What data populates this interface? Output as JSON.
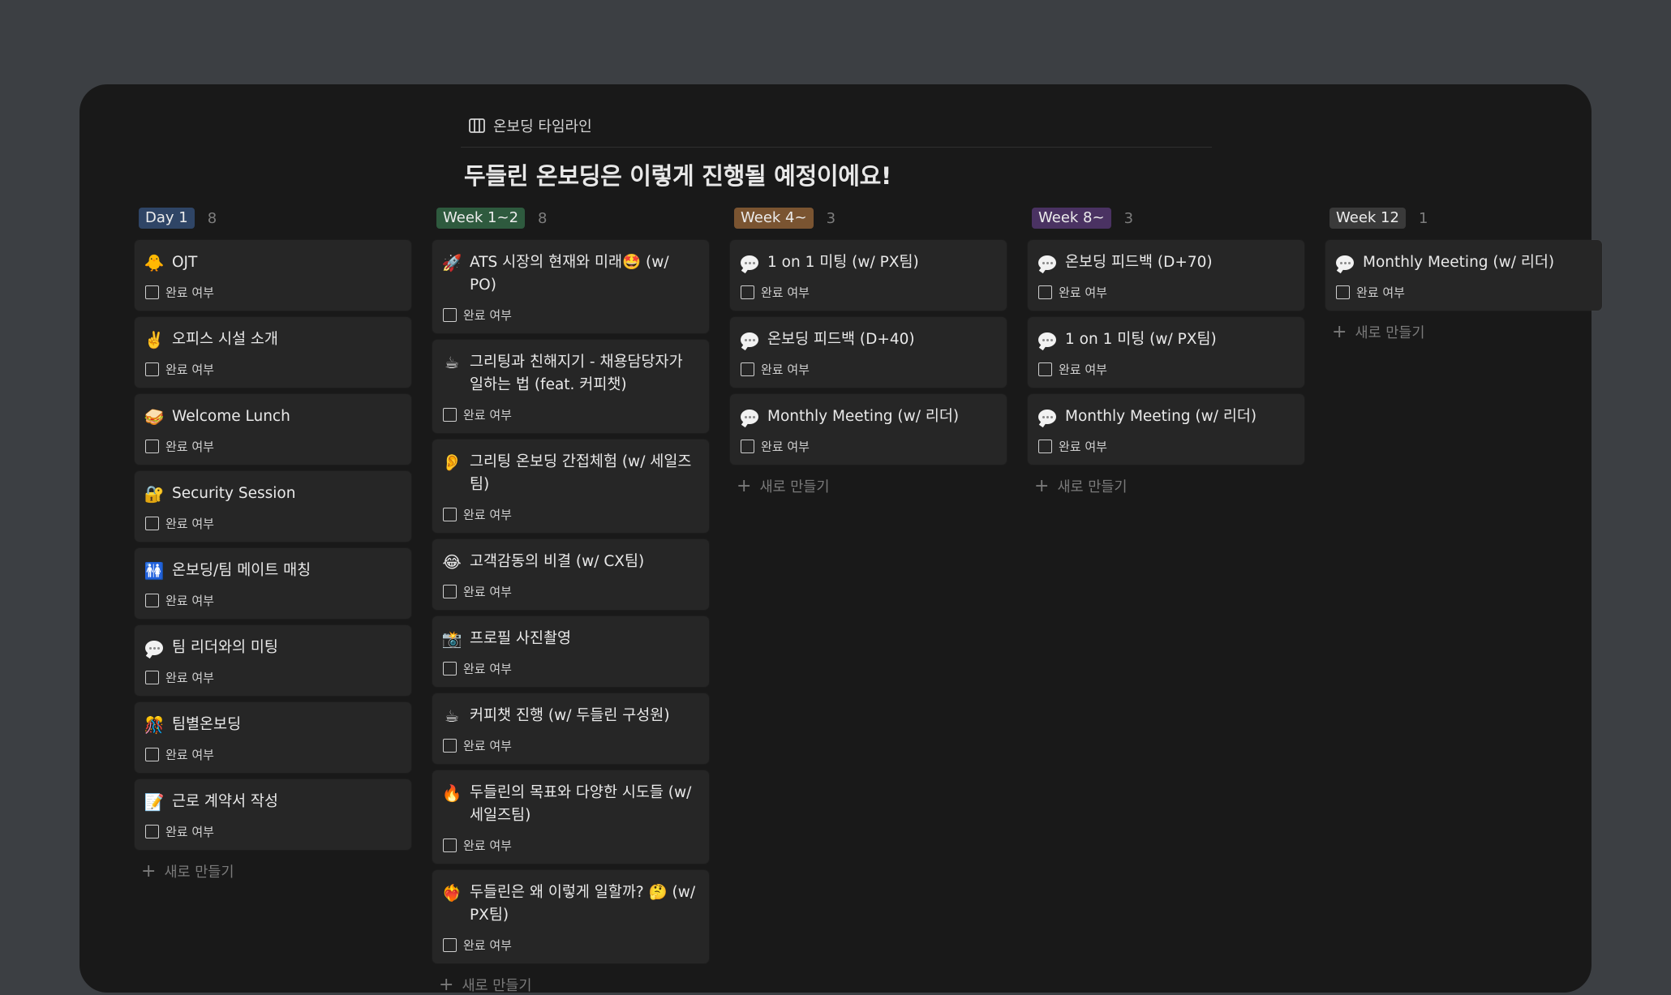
{
  "view": {
    "label": "온보딩 타임라인",
    "icon": "board-view-icon"
  },
  "page_title": "두들린 온보딩은 이렇게 진행될 예정이에요!",
  "checkbox_label": "완료 여부",
  "new_label": "새로 만들기",
  "columns": [
    {
      "name": "Day 1",
      "count": "8",
      "color": "#2f4566",
      "cards": [
        {
          "title": "OJT",
          "emoji": "🐥",
          "icon": "chick-icon"
        },
        {
          "title": "오피스 시설 소개",
          "emoji": "✌️",
          "icon": "victory-hand-icon"
        },
        {
          "title": "Welcome Lunch",
          "emoji": "🥪",
          "icon": "sandwich-icon"
        },
        {
          "title": "Security Session",
          "emoji": "🔐",
          "icon": "lock-key-icon"
        },
        {
          "title": "온보딩/팀 메이트 매칭",
          "emoji": "🚻",
          "icon": "people-icon"
        },
        {
          "title": "팀 리더와의 미팅",
          "emoji": "💬",
          "icon": "speech-bubble-icon"
        },
        {
          "title": "팀별온보딩",
          "emoji": "🎊",
          "icon": "celebration-icon"
        },
        {
          "title": "근로 계약서 작성",
          "emoji": "📝",
          "icon": "memo-icon"
        }
      ]
    },
    {
      "name": "Week 1~2",
      "count": "8",
      "color": "#2e5a3e",
      "cards": [
        {
          "title": "ATS 시장의 현재와 미래🤩 (w/ PO)",
          "emoji": "🚀",
          "icon": "rocket-icon"
        },
        {
          "title": "그리팅과 친해지기 - 채용담당자가 일하는 법 (feat. 커피챗)",
          "emoji": "☕",
          "icon": "coffee-icon"
        },
        {
          "title": "그리팅 온보딩 간접체험 (w/ 세일즈팀)",
          "emoji": "👂",
          "icon": "ear-icon"
        },
        {
          "title": "고객감동의 비결 (w/ CX팀)",
          "emoji": "😂",
          "icon": "tears-of-joy-icon"
        },
        {
          "title": "프로필 사진촬영",
          "emoji": "📸",
          "icon": "camera-icon"
        },
        {
          "title": "커피챗 진행 (w/ 두들린 구성원)",
          "emoji": "☕",
          "icon": "coffee-icon"
        },
        {
          "title": "두들린의 목표와 다양한 시도들 (w/ 세일즈팀)",
          "emoji": "🔥",
          "icon": "fire-icon"
        },
        {
          "title": "두들린은 왜 이렇게 일할까? 🤔 (w/ PX팀)",
          "emoji": "❤️‍🔥",
          "icon": "heart-on-fire-icon"
        }
      ]
    },
    {
      "name": "Week 4~",
      "count": "3",
      "color": "#7a5431",
      "cards": [
        {
          "title": "1 on 1 미팅 (w/ PX팀)",
          "emoji": "💬",
          "icon": "speech-bubble-icon"
        },
        {
          "title": "온보딩 피드백 (D+40)",
          "emoji": "💬",
          "icon": "speech-bubble-icon"
        },
        {
          "title": "Monthly Meeting (w/ 리더)",
          "emoji": "💬",
          "icon": "speech-bubble-icon"
        }
      ]
    },
    {
      "name": "Week 8~",
      "count": "3",
      "color": "#4a3262",
      "cards": [
        {
          "title": "온보딩 피드백 (D+70)",
          "emoji": "💬",
          "icon": "speech-bubble-icon"
        },
        {
          "title": "1 on 1 미팅 (w/ PX팀)",
          "emoji": "💬",
          "icon": "speech-bubble-icon"
        },
        {
          "title": "Monthly Meeting (w/ 리더)",
          "emoji": "💬",
          "icon": "speech-bubble-icon"
        }
      ]
    },
    {
      "name": "Week 12",
      "count": "1",
      "color": "#3a3a3a",
      "cards": [
        {
          "title": "Monthly Meeting (w/ 리더)",
          "emoji": "💬",
          "icon": "speech-bubble-icon"
        }
      ]
    }
  ]
}
